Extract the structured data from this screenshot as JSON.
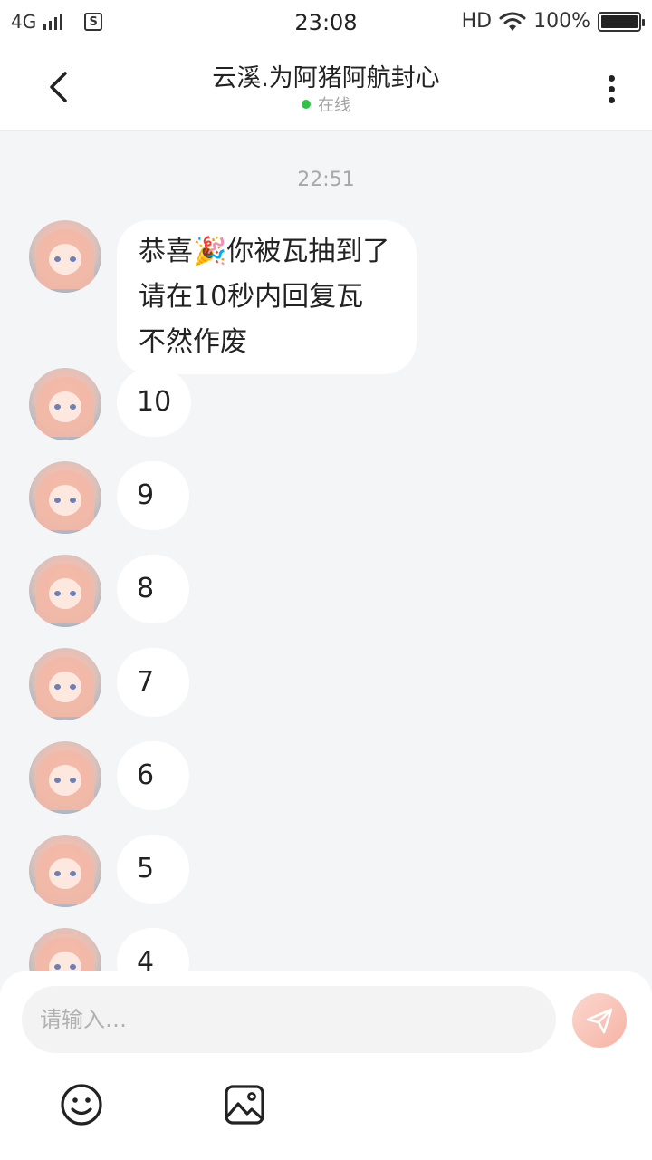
{
  "status_bar": {
    "network": "4G",
    "sim_label": "S",
    "time": "23:08",
    "hd": "HD",
    "battery": "100%",
    "battery_level": 1.0
  },
  "header": {
    "title": "云溪.为阿猪阿航封心",
    "status": "在线",
    "status_color": "#2fc247"
  },
  "chat": {
    "timestamp": "22:51",
    "messages": [
      {
        "lines": [
          "恭喜🎉你被瓦抽到了",
          "请在10秒内回复瓦",
          "不然作废"
        ]
      },
      {
        "text": "10"
      },
      {
        "text": "9"
      },
      {
        "text": "8"
      },
      {
        "text": "7"
      },
      {
        "text": "6"
      },
      {
        "text": "5"
      },
      {
        "text": "4"
      }
    ]
  },
  "composer": {
    "placeholder": "请输入…",
    "send_icon": "paper-plane-icon",
    "emoji_icon": "smiley-icon",
    "image_icon": "image-icon"
  },
  "colors": {
    "background": "#f4f5f7",
    "bubble": "#ffffff",
    "send_button": "#f6b3a5"
  }
}
